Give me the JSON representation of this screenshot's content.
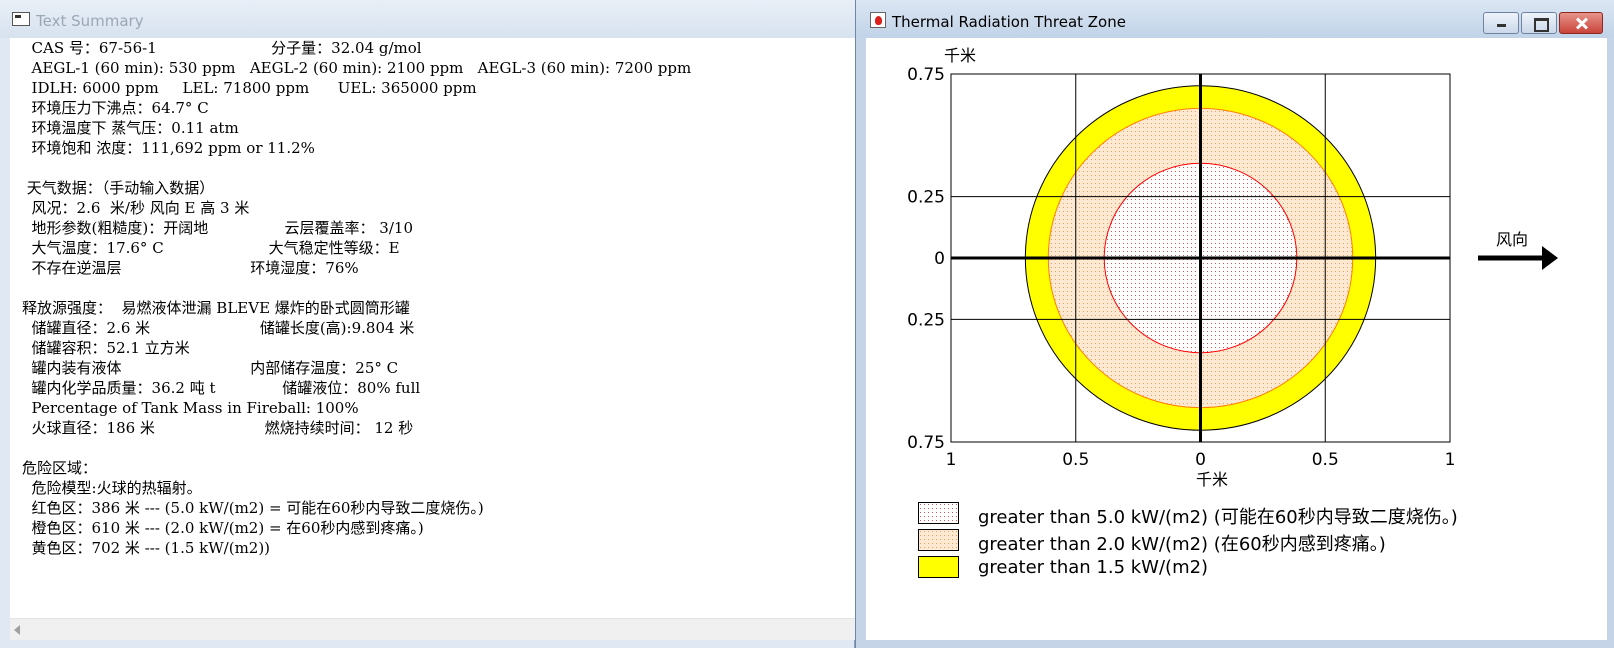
{
  "left_window": {
    "title": "Text Summary",
    "lines": [
      "  CAS 号：67-56-1                        分子量：32.04 g/mol",
      "  AEGL-1 (60 min): 530 ppm   AEGL-2 (60 min): 2100 ppm   AEGL-3 (60 min): 7200 ppm",
      "  IDLH: 6000 ppm     LEL: 71800 ppm      UEL: 365000 ppm",
      "  环境压力下沸点：64.7° C",
      "  环境温度下 蒸气压：0.11 atm",
      "  环境饱和 浓度：111,692 ppm or 11.2%",
      "",
      " 天气数据：（手动输入数据）",
      "  风况：2.6  米/秒 风向 E 高 3 米",
      "  地形参数(粗糙度)：开阔地                云层覆盖率： 3/10",
      "  大气温度：17.6° C                      大气稳定性等级：E",
      "  不存在逆温层                           环境湿度：76%",
      "",
      "释放源强度：  易燃液体泄漏 BLEVE 爆炸的卧式圆筒形罐",
      "  储罐直径：2.6 米                       储罐长度(高):9.804 米",
      "  储罐容积：52.1 立方米",
      "  罐内装有液体                           内部储存温度：25° C",
      "  罐内化学品质量：36.2 吨 t              储罐液位：80% full",
      "  Percentage of Tank Mass in Fireball: 100%",
      "  火球直径：186 米                       燃烧持续时间： 12 秒",
      "",
      "危险区域：",
      "  危险模型:火球的热辐射。",
      "  红色区：386 米 --- (5.0 kW/(m2) = 可能在60秒内导致二度烧伤。)",
      "  橙色区：610 米 --- (2.0 kW/(m2) = 在60秒内感到疼痛。)",
      "  黄色区：702 米 --- (1.5 kW/(m2))"
    ]
  },
  "right_window": {
    "title": "Thermal Radiation Threat Zone",
    "wind_label": "风向",
    "legend": [
      {
        "text": "greater than 5.0 kW/(m2) (可能在60秒内导致二度烧伤。)",
        "color": "#ff0000",
        "fill": "#fbe4e4"
      },
      {
        "text": "greater than 2.0 kW/(m2) (在60秒内感到疼痛。)",
        "color": "#ff8000",
        "fill": "#fbe2c6"
      },
      {
        "text": "greater than 1.5 kW/(m2)",
        "color": "#ffff00",
        "fill": "#ffff00"
      }
    ]
  },
  "chart_data": {
    "type": "threat-zone-map",
    "xlabel": "千米",
    "ylabel": "千米",
    "x_ticks": [
      "1",
      "0.5",
      "0",
      "0.5",
      "1"
    ],
    "y_ticks": [
      "0.75",
      "0.25",
      "0",
      "0.25",
      "0.75"
    ],
    "xlim": [
      -1,
      1
    ],
    "ylim": [
      -0.75,
      0.75
    ],
    "grid": true,
    "zones": [
      {
        "name": "yellow",
        "radius_km": 0.702,
        "color": "#ffff00"
      },
      {
        "name": "orange",
        "radius_km": 0.61,
        "color": "#ff8000"
      },
      {
        "name": "red",
        "radius_km": 0.386,
        "color": "#ff0000"
      }
    ],
    "wind_direction": "right"
  }
}
